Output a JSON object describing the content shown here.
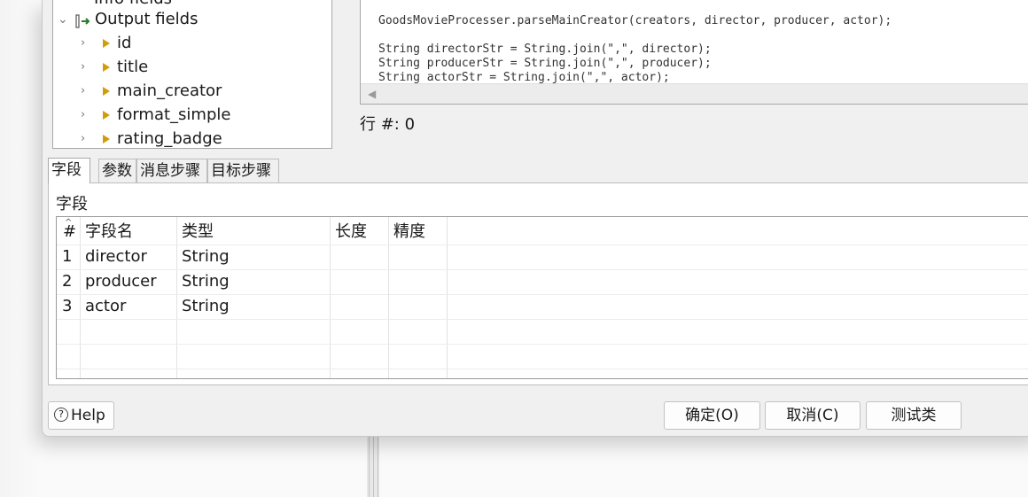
{
  "tree": {
    "partial_item": "Info fields",
    "output_fields_label": "Output fields",
    "items": [
      "id",
      "title",
      "main_creator",
      "format_simple",
      "rating_badge"
    ]
  },
  "code": {
    "lines": [
      "GoodsMovieProcesser.parseMainCreator(creators, director, producer, actor);",
      "",
      "String directorStr = String.join(\",\", director);",
      "String producerStr = String.join(\",\", producer);",
      "String actorStr = String.join(\",\", actor);"
    ]
  },
  "row_indicator": "行 #: 0",
  "tabs": [
    "字段",
    "参数",
    "消息步骤",
    "目标步骤"
  ],
  "fields_panel": {
    "title": "字段",
    "columns": [
      "#",
      "字段名",
      "类型",
      "长度",
      "精度"
    ],
    "rows": [
      {
        "num": "1",
        "name": "director",
        "type": "String",
        "length": "",
        "precision": ""
      },
      {
        "num": "2",
        "name": "producer",
        "type": "String",
        "length": "",
        "precision": ""
      },
      {
        "num": "3",
        "name": "actor",
        "type": "String",
        "length": "",
        "precision": ""
      }
    ]
  },
  "buttons": {
    "help": "Help",
    "ok": "确定(O)",
    "cancel": "取消(C)",
    "test": "测试类"
  },
  "colors": {
    "dialog_bg": "#f0f0f0",
    "field_triangle": "#d39b0a",
    "output_icon": "#2a7a2a"
  }
}
